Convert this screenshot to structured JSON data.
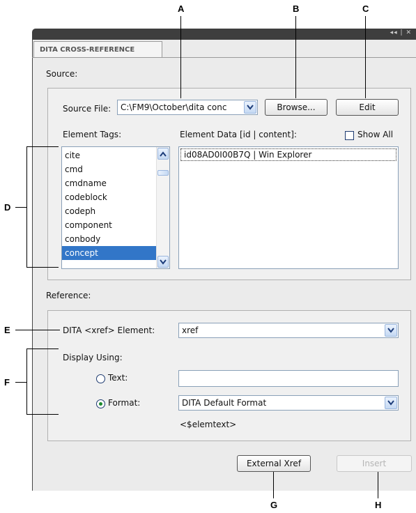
{
  "callouts": {
    "a": "A",
    "b": "B",
    "c": "C",
    "d": "D",
    "e": "E",
    "f": "F",
    "g": "G",
    "h": "H"
  },
  "panel": {
    "tab_label": "DITA CROSS-REFERENCE",
    "window_controls": "◂◂ | ✕"
  },
  "source": {
    "section_label": "Source:",
    "file_label": "Source File:",
    "file_value": "C:\\FM9\\October\\dita conc",
    "browse_label": "Browse...",
    "edit_label": "Edit",
    "element_tags_label": "Element Tags:",
    "element_tags": [
      "cite",
      "cmd",
      "cmdname",
      "codeblock",
      "codeph",
      "component",
      "conbody",
      "concept"
    ],
    "selected_tag": "concept",
    "element_data_label": "Element Data [id | content]:",
    "show_all_label": "Show All",
    "show_all_checked": false,
    "element_data": [
      "id08AD0I00B7Q | Win Explorer"
    ]
  },
  "reference": {
    "section_label": "Reference:",
    "xref_label": "DITA <xref> Element:",
    "xref_value": "xref",
    "display_using_label": "Display Using:",
    "text_label": "Text:",
    "text_value": "",
    "format_label": "Format:",
    "format_value": "DITA Default Format",
    "format_selected": true,
    "format_preview": "<$elemtext>"
  },
  "footer": {
    "external_xref_label": "External Xref",
    "insert_label": "Insert"
  }
}
